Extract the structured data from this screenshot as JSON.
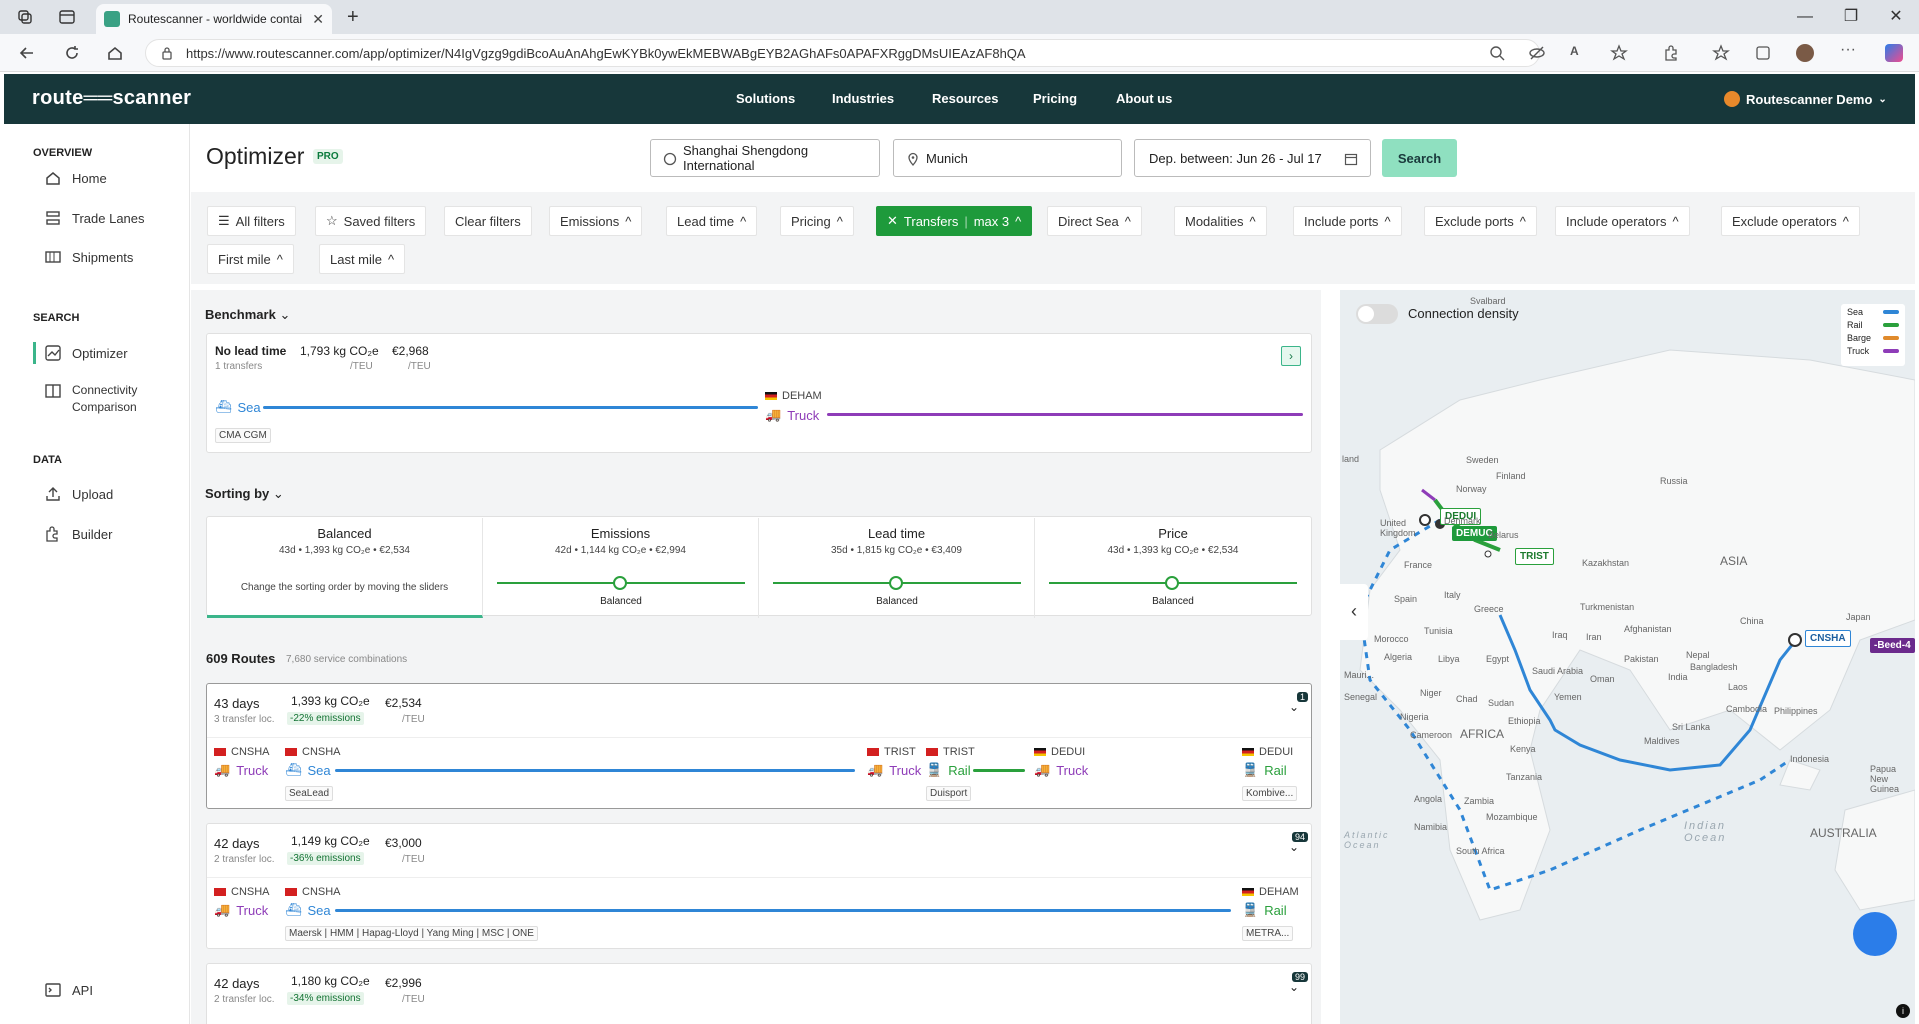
{
  "browser": {
    "tab_title": "Routescanner - worldwide contai",
    "url": "https://www.routescanner.com/app/optimizer/N4IgVgzg9gdiBcoAuAnAhgEwKYBk0ywEkMEBWABgEYB2AGhAFs0APAFXRggDMsUIEAzAF8hQA"
  },
  "app": {
    "logo": "route══scanner",
    "nav": [
      "Solutions",
      "Industries",
      "Resources",
      "Pricing",
      "About us"
    ],
    "user": "Routescanner Demo"
  },
  "sidebar": {
    "overview_label": "OVERVIEW",
    "home": "Home",
    "trade_lanes": "Trade Lanes",
    "shipments": "Shipments",
    "search_label": "SEARCH",
    "optimizer": "Optimizer",
    "connectivity": "Connectivity Comparison",
    "data_label": "DATA",
    "upload": "Upload",
    "builder": "Builder",
    "api": "API"
  },
  "header": {
    "title": "Optimizer",
    "pro_badge": "PRO",
    "origin": "Shanghai Shengdong International",
    "destination": "Munich",
    "dates": "Dep. between: Jun 26 - Jul 17",
    "search": "Search"
  },
  "filters": {
    "all": "All filters",
    "saved": "Saved filters",
    "clear": "Clear filters",
    "emissions": "Emissions",
    "lead_time": "Lead time",
    "pricing": "Pricing",
    "transfers": "Transfers",
    "transfers_value": "max 3",
    "direct_sea": "Direct Sea",
    "modalities": "Modalities",
    "include_ports": "Include ports",
    "exclude_ports": "Exclude ports",
    "include_operators": "Include operators",
    "exclude_operators": "Exclude operators",
    "first_mile": "First mile",
    "last_mile": "Last mile"
  },
  "benchmark": {
    "title": "Benchmark",
    "lead": "No lead time",
    "transfers": "1 transfers",
    "co2": "1,793 kg CO₂e",
    "co2_unit": "/TEU",
    "price": "€2,968",
    "price_unit": "/TEU",
    "sea": "Sea",
    "operator": "CMA CGM",
    "port": "DEHAM",
    "truck": "Truck"
  },
  "sorting": {
    "title": "Sorting by",
    "cols": [
      {
        "name": "Balanced",
        "stats": "43d • 1,393 kg CO₂e • €2,534",
        "note": "Change the sorting order by moving the sliders"
      },
      {
        "name": "Emissions",
        "stats": "42d • 1,144 kg CO₂e • €2,994",
        "label": "Balanced"
      },
      {
        "name": "Lead time",
        "stats": "35d • 1,815 kg CO₂e • €3,409",
        "label": "Balanced"
      },
      {
        "name": "Price",
        "stats": "43d • 1,393 kg CO₂e • €2,534",
        "label": "Balanced"
      }
    ]
  },
  "routes": {
    "count": "609 Routes",
    "combos": "7,680 service combinations",
    "items": [
      {
        "days": "43 days",
        "transfers": "3 transfer loc.",
        "co2": "1,393 kg CO₂e",
        "em": "-22% emissions",
        "price": "€2,534",
        "unit": "/TEU",
        "badge": "1",
        "legs": [
          "CNSHA",
          "CNSHA",
          "TRIST",
          "TRIST",
          "DEDUI",
          "DEDUI"
        ],
        "modes": [
          "Truck",
          "Sea",
          "Truck",
          "Rail",
          "Truck",
          "Rail"
        ],
        "ops": [
          "SeaLead",
          "Duisport",
          "Kombive..."
        ]
      },
      {
        "days": "42 days",
        "transfers": "2 transfer loc.",
        "co2": "1,149 kg CO₂e",
        "em": "-36% emissions",
        "price": "€3,000",
        "unit": "/TEU",
        "badge": "94",
        "legs": [
          "CNSHA",
          "CNSHA",
          "DEHAM"
        ],
        "modes": [
          "Truck",
          "Sea",
          "Rail"
        ],
        "ops": [
          "Maersk | HMM | Hapag-Lloyd | Yang Ming | MSC | ONE",
          "METRA..."
        ]
      },
      {
        "days": "42 days",
        "transfers": "2 transfer loc.",
        "co2": "1,180 kg CO₂e",
        "em": "-34% emissions",
        "price": "€2,996",
        "unit": "/TEU",
        "badge": "99"
      }
    ]
  },
  "map": {
    "toggle": "Connection density",
    "legend": [
      "Sea",
      "Rail",
      "Barge",
      "Truck"
    ],
    "colors": {
      "sea": "#2f86d6",
      "rail": "#2aa03c",
      "barge": "#e08a2b",
      "truck": "#8e3cb8"
    },
    "pins": [
      "DEDUI",
      "DEMUC",
      "TRIST",
      "CNSHA",
      "-Beed-4"
    ],
    "labels": [
      "Svalbard",
      "Sweden",
      "Finland",
      "Norway",
      "Russia",
      "Denmark",
      "United Kingdom",
      "Belarus",
      "France",
      "Kazakhstan",
      "ASIA",
      "Spain",
      "Italy",
      "Turkmenistan",
      "Greece",
      "Tunisia",
      "Iraq",
      "Iran",
      "Afghanistan",
      "Morocco",
      "Algeria",
      "Libya",
      "Egypt",
      "Saudi Arabia",
      "Oman",
      "Pakistan",
      "Nepal",
      "China",
      "Japan",
      "Bangladesh",
      "India",
      "Laos",
      "Niger",
      "Chad",
      "Sudan",
      "Yemen",
      "Cambodia",
      "Philippines",
      "Senegal",
      "Nigeria",
      "Ethiopia",
      "Sri Lanka",
      "Cameroon",
      "AFRICA",
      "Kenya",
      "Maldives",
      "Indonesia",
      "Tanzania",
      "Angola",
      "Zambia",
      "Mozambique",
      "Namibia",
      "South Africa",
      "Indian Ocean",
      "AUSTRALIA",
      "Papua New Guinea",
      "land",
      "Atlantic Ocean",
      "Mauri..."
    ]
  }
}
